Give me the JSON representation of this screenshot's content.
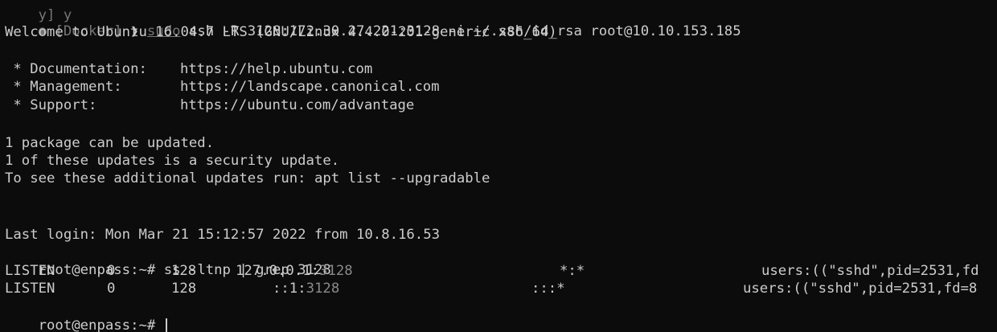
{
  "top_fragment": "y] y ",
  "prompt": {
    "bullet": "●",
    "context": "[Docker]",
    "arrow": "❯",
    "sudo": "sudo",
    "command": "ssh -R 3128:172.30.27.221:3128 -i ~/.ssh/id_rsa root@10.10.153.185"
  },
  "motd": {
    "welcome": "Welcome to Ubuntu 16.04.7 LTS (GNU/Linux 4.4.0-201-generic x86_64)",
    "links": [
      {
        "label": " * Documentation:",
        "url": "https://help.ubuntu.com"
      },
      {
        "label": " * Management:",
        "url": "https://landscape.canonical.com"
      },
      {
        "label": " * Support:",
        "url": "https://ubuntu.com/advantage"
      }
    ],
    "updates": [
      "1 package can be updated.",
      "1 of these updates is a security update.",
      "To see these additional updates run: apt list --upgradable"
    ],
    "last_login": "Last login: Mon Mar 21 15:12:57 2022 from 10.8.16.53"
  },
  "remote_prompt": "root@enpass:~#",
  "ss_command": "ss -ltnp | grep 3128",
  "ss_rows": [
    {
      "state": "LISTEN",
      "recvq": "0",
      "sendq": "128",
      "local_addr": "127.0.0.1:",
      "local_port": "3128",
      "peer": "*:*",
      "process": "users:((\"sshd\",pid=2531,fd"
    },
    {
      "state": "LISTEN",
      "recvq": "0",
      "sendq": "128",
      "local_addr": "::1:",
      "local_port": "3128",
      "peer": ":::*",
      "process": "users:((\"sshd\",pid=2531,fd=8"
    }
  ]
}
